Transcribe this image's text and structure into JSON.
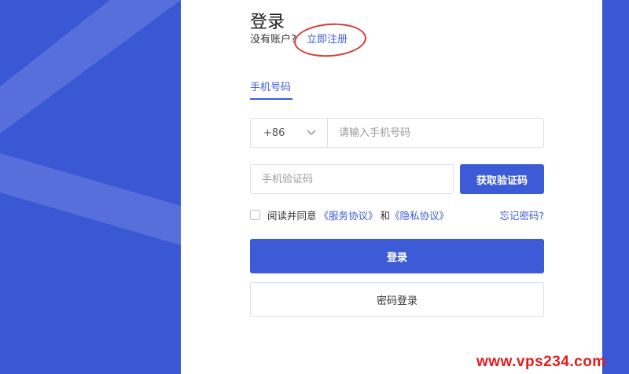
{
  "login": {
    "title": "登录",
    "no_account_text": "没有账户?",
    "register_link": "立即注册",
    "tab_phone": "手机号码",
    "country_code": "+86",
    "phone_placeholder": "请输入手机号码",
    "code_placeholder": "手机验证码",
    "get_code_label": "获取验证码",
    "agree_prefix": "阅读并同意",
    "service_agreement": "《服务协议》",
    "and_text": "和",
    "privacy_agreement": "《隐私协议》",
    "forgot_password": "忘记密码?",
    "login_button": "登录",
    "password_login_button": "密码登录"
  },
  "watermark": "www.vps234.com",
  "colors": {
    "accent": "#3d5bd6",
    "annotation_circle": "#d43a3a",
    "watermark": "#e21c1c"
  },
  "icons": {
    "country_dropdown": "chevron-down-icon"
  }
}
